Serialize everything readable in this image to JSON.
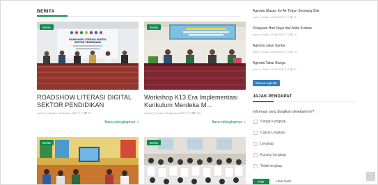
{
  "berita": {
    "heading": "BERITA",
    "cards": [
      {
        "badge": "Berita",
        "banner": "ROADSHOW LITERASI DIGITAL SEKTOR PENDIDIKAN",
        "title": "ROADSHOW LITERASI DIGITAL SEKTOR PENDIDIKAN",
        "meta": "admin  ◷ Selasa, 4 Oktober 2022   ✎ 0   👁 31",
        "read_more": "Baca selengkapnya"
      },
      {
        "badge": "Berita",
        "title": "Workshop K13 Era Implementasi Kurikulum Merdeka M...",
        "meta": "admin  ◷ Kamis, 25 Agustus 2022   ✎ 0   👁 115",
        "read_more": "Baca selengkapnya"
      },
      {
        "badge": "Berita"
      },
      {
        "badge": "Berita"
      }
    ]
  },
  "agenda": {
    "items": [
      {
        "title": "Agenda Ulasan Ke Air Terjun Sendang Gile",
        "meta": "admin  ◷ Rabu, 16 Mei 2022   ✎ 0   👁 16"
      },
      {
        "title": "Perayaan Hari Raya Idul Adha Kurban",
        "meta": "admin  ◷ Rabu, 16 Mei 2022   ✎ 0   👁 13"
      },
      {
        "title": "Agenda Jalan Santai",
        "meta": "admin  ◷ Rabu, 16 Mei 2022   ✎ 0   👁 13"
      },
      {
        "title": "Agenda Tabur Bunga",
        "meta": "admin  ◷ Rabu, 16 Mei 2022   ✎ 0   👁 17"
      }
    ],
    "all_button": "Semua Agenda"
  },
  "poll": {
    "heading": "JAJAK PENDAPAT",
    "question": "Informasi yang disajikan diwebsite ini?",
    "options": [
      "Sangat Lengkap",
      "Cukup Lengkap",
      "Lengkap",
      "Kurang Lengkap",
      "Tidak lengkap"
    ],
    "submit": "Pilih",
    "results": "Lihat Hasil"
  },
  "colors": {
    "accent": "#0f8a4a",
    "button_blue": "#2f7fc1"
  },
  "icons": {
    "scroll_top": "arrow-up-icon"
  }
}
